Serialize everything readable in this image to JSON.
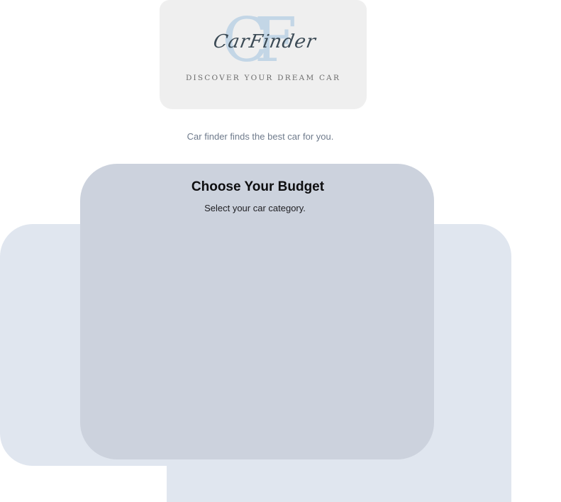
{
  "logo": {
    "monogram": "CF",
    "script_name": "CarFinder",
    "tagline": "DISCOVER YOUR DREAM CAR"
  },
  "intro": {
    "text": "Car finder finds the best car for you."
  },
  "budget": {
    "title": "Choose Your Budget",
    "subtitle": "Select your car category."
  },
  "colors": {
    "page_background": "#ffffff",
    "logo_card": "#efefef",
    "monogram": "#c3d6e6",
    "card": "#ccd2dd",
    "back_panel": "#e0e6ef",
    "intro_text": "#6f7b8c"
  }
}
